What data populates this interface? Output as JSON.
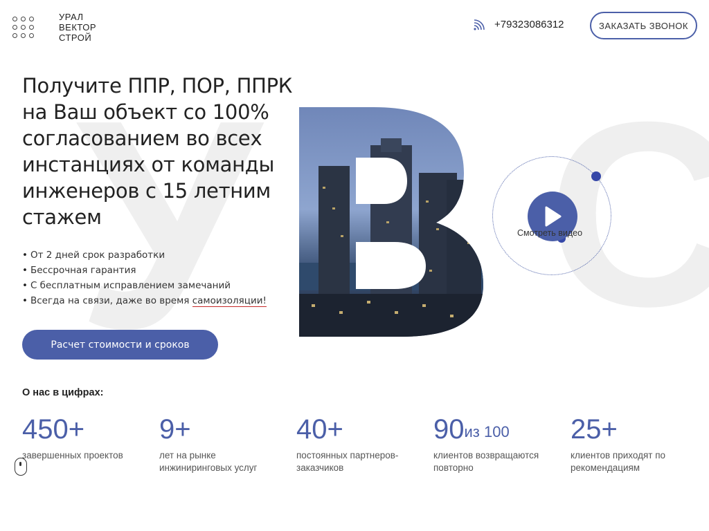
{
  "header": {
    "logo_lines": [
      "УРАЛ",
      "ВЕКТОР",
      "СТРОЙ"
    ],
    "phone": "+79323086312",
    "call_button": "ЗАКАЗАТЬ ЗВОНОК"
  },
  "hero": {
    "bg_letter_left": "У",
    "bg_letter_right": "С",
    "headline": "Получите ППР, ПОР, ППРК на Ваш объект со 100% согласованием во всех инстанциях от команды инженеров с 15 летним стажем",
    "bullets": [
      {
        "text": "От 2 дней срок разработки"
      },
      {
        "text": "Бессрочная гарантия"
      },
      {
        "text": "С бесплатным исправлением замечаний"
      },
      {
        "text_before": "Всегда на связи, даже во время ",
        "underlined": "самоизоляции!"
      }
    ],
    "cta_button": "Расчет стоимости и сроков",
    "video_label": "Смотреть видео"
  },
  "about": {
    "title": "О нас в цифрах:",
    "stats": [
      {
        "value": "450+",
        "suffix": "",
        "label": "завершенных проектов"
      },
      {
        "value": "9+",
        "suffix": "",
        "label": "лет на рынке инжиниринговых услуг"
      },
      {
        "value": "40+",
        "suffix": "",
        "label": "постоянных партнеров-заказчиков"
      },
      {
        "value": "90",
        "suffix": "из 100",
        "label": "клиентов возвращаются повторно"
      },
      {
        "value": "25+",
        "suffix": "",
        "label": "клиентов приходят по рекомендациям"
      }
    ]
  },
  "colors": {
    "accent": "#4b5fa8",
    "accent_dark": "#3547a8",
    "underline": "#c62828"
  }
}
